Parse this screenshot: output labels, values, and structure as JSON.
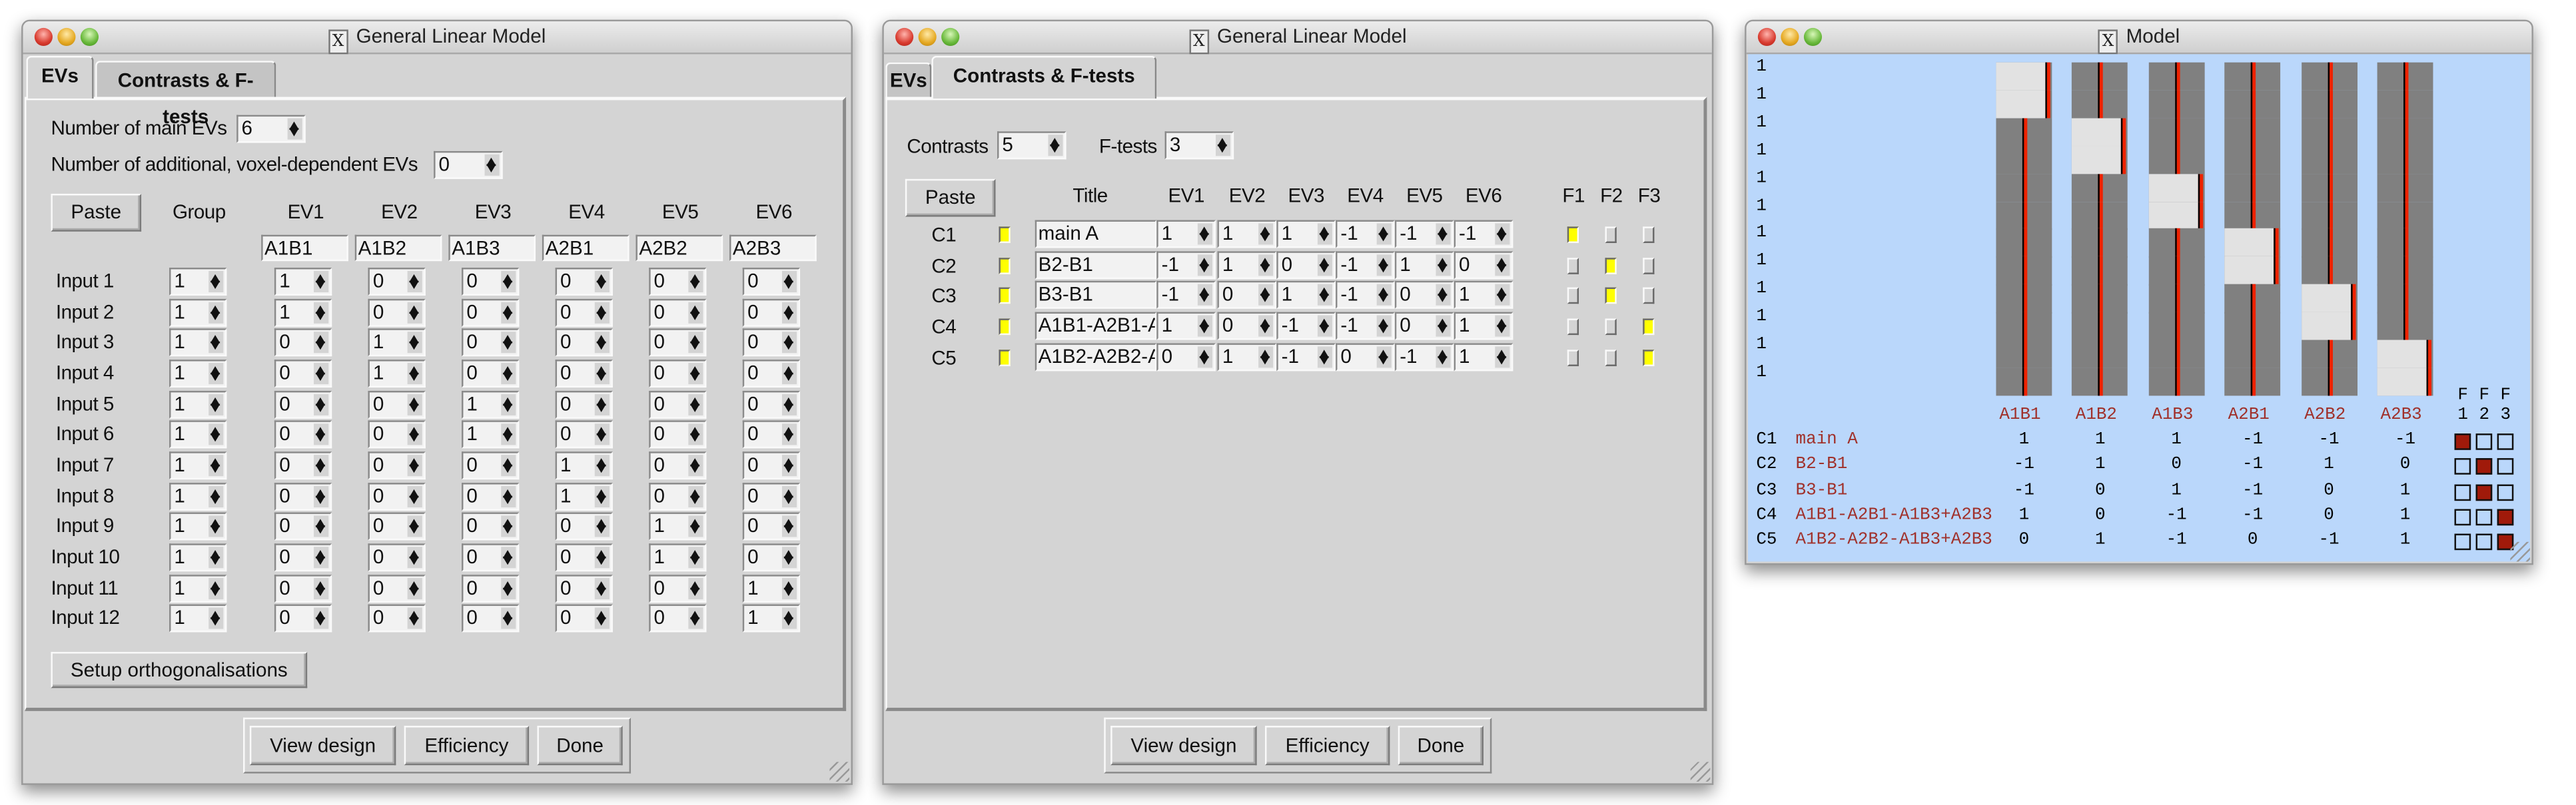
{
  "glm_evs": {
    "title": "General Linear Model",
    "tabs": [
      "EVs",
      "Contrasts & F-tests"
    ],
    "active_tab": "EVs",
    "num_main_evs_label": "Number of main EVs",
    "num_main_evs": "6",
    "num_additional_label": "Number of additional, voxel-dependent EVs",
    "num_additional": "0",
    "paste_label": "Paste",
    "group_header": "Group",
    "ev_headers": [
      "EV1",
      "EV2",
      "EV3",
      "EV4",
      "EV5",
      "EV6"
    ],
    "ev_names": [
      "A1B1",
      "A1B2",
      "A1B3",
      "A2B1",
      "A2B2",
      "A2B3"
    ],
    "inputs": [
      {
        "label": "Input 1",
        "group": "1",
        "evs": [
          "1",
          "0",
          "0",
          "0",
          "0",
          "0"
        ]
      },
      {
        "label": "Input 2",
        "group": "1",
        "evs": [
          "1",
          "0",
          "0",
          "0",
          "0",
          "0"
        ]
      },
      {
        "label": "Input 3",
        "group": "1",
        "evs": [
          "0",
          "1",
          "0",
          "0",
          "0",
          "0"
        ]
      },
      {
        "label": "Input 4",
        "group": "1",
        "evs": [
          "0",
          "1",
          "0",
          "0",
          "0",
          "0"
        ]
      },
      {
        "label": "Input 5",
        "group": "1",
        "evs": [
          "0",
          "0",
          "1",
          "0",
          "0",
          "0"
        ]
      },
      {
        "label": "Input 6",
        "group": "1",
        "evs": [
          "0",
          "0",
          "1",
          "0",
          "0",
          "0"
        ]
      },
      {
        "label": "Input 7",
        "group": "1",
        "evs": [
          "0",
          "0",
          "0",
          "1",
          "0",
          "0"
        ]
      },
      {
        "label": "Input 8",
        "group": "1",
        "evs": [
          "0",
          "0",
          "0",
          "1",
          "0",
          "0"
        ]
      },
      {
        "label": "Input 9",
        "group": "1",
        "evs": [
          "0",
          "0",
          "0",
          "0",
          "1",
          "0"
        ]
      },
      {
        "label": "Input 10",
        "group": "1",
        "evs": [
          "0",
          "0",
          "0",
          "0",
          "1",
          "0"
        ]
      },
      {
        "label": "Input 11",
        "group": "1",
        "evs": [
          "0",
          "0",
          "0",
          "0",
          "0",
          "1"
        ]
      },
      {
        "label": "Input 12",
        "group": "1",
        "evs": [
          "0",
          "0",
          "0",
          "0",
          "0",
          "1"
        ]
      }
    ],
    "setup_orth_label": "Setup orthogonalisations",
    "buttons": [
      "View design",
      "Efficiency",
      "Done"
    ]
  },
  "glm_contrasts": {
    "title": "General Linear Model",
    "tabs": [
      "EVs",
      "Contrasts & F-tests"
    ],
    "active_tab": "Contrasts & F-tests",
    "contrasts_label": "Contrasts",
    "contrasts": "5",
    "ftests_label": "F-tests",
    "ftests": "3",
    "paste_label": "Paste",
    "title_header": "Title",
    "ev_headers": [
      "EV1",
      "EV2",
      "EV3",
      "EV4",
      "EV5",
      "EV6"
    ],
    "f_headers": [
      "F1",
      "F2",
      "F3"
    ],
    "rows": [
      {
        "label": "C1",
        "enabled": true,
        "title": "main A",
        "evs": [
          "1",
          "1",
          "1",
          "-1",
          "-1",
          "-1"
        ],
        "f": [
          true,
          false,
          false
        ]
      },
      {
        "label": "C2",
        "enabled": true,
        "title": "B2-B1",
        "evs": [
          "-1",
          "1",
          "0",
          "-1",
          "1",
          "0"
        ],
        "f": [
          false,
          true,
          false
        ]
      },
      {
        "label": "C3",
        "enabled": true,
        "title": "B3-B1",
        "evs": [
          "-1",
          "0",
          "1",
          "-1",
          "0",
          "1"
        ],
        "f": [
          false,
          true,
          false
        ]
      },
      {
        "label": "C4",
        "enabled": true,
        "title": "A1B1-A2B1-A1B3+A2B3",
        "evs": [
          "1",
          "0",
          "-1",
          "-1",
          "0",
          "1"
        ],
        "f": [
          false,
          false,
          true
        ]
      },
      {
        "label": "C5",
        "enabled": true,
        "title": "A1B2-A2B2-A1B3+A2B3",
        "evs": [
          "0",
          "1",
          "-1",
          "0",
          "-1",
          "1"
        ],
        "f": [
          false,
          false,
          true
        ]
      }
    ],
    "buttons": [
      "View design",
      "Efficiency",
      "Done"
    ]
  },
  "model": {
    "title": "Model",
    "group_column": [
      "1",
      "1",
      "1",
      "1",
      "1",
      "1",
      "1",
      "1",
      "1",
      "1",
      "1",
      "1"
    ],
    "ev_names": [
      "A1B1",
      "A1B2",
      "A1B3",
      "A2B1",
      "A2B2",
      "A2B3"
    ],
    "f_headers": [
      {
        "letter": "F",
        "num": "1"
      },
      {
        "letter": "F",
        "num": "2"
      },
      {
        "letter": "F",
        "num": "3"
      }
    ],
    "contrasts": [
      {
        "label": "C1",
        "name": "main A",
        "values": [
          "1",
          "1",
          "1",
          "-1",
          "-1",
          "-1"
        ],
        "f": [
          true,
          false,
          false
        ]
      },
      {
        "label": "C2",
        "name": "B2-B1",
        "values": [
          "-1",
          "1",
          "0",
          "-1",
          "1",
          "0"
        ],
        "f": [
          false,
          true,
          false
        ]
      },
      {
        "label": "C3",
        "name": "B3-B1",
        "values": [
          "-1",
          "0",
          "1",
          "-1",
          "0",
          "1"
        ],
        "f": [
          false,
          true,
          false
        ]
      },
      {
        "label": "C4",
        "name": "A1B1-A2B1-A1B3+A2B3",
        "values": [
          "1",
          "0",
          "-1",
          "-1",
          "0",
          "1"
        ],
        "f": [
          false,
          false,
          true
        ]
      },
      {
        "label": "C5",
        "name": "A1B2-A2B2-A1B3+A2B3",
        "values": [
          "0",
          "1",
          "-1",
          "0",
          "-1",
          "1"
        ],
        "f": [
          false,
          false,
          true
        ]
      }
    ]
  },
  "colors": {
    "window_bg": "#d4d4d4",
    "model_bg": "#bad7fb",
    "checkbox_on": "#ffff00",
    "model_line": "#ee2200",
    "model_dark": "#808080",
    "model_light": "#e2e2e2",
    "model_text": "#a0302a",
    "ftest_on": "#a01a0a"
  }
}
